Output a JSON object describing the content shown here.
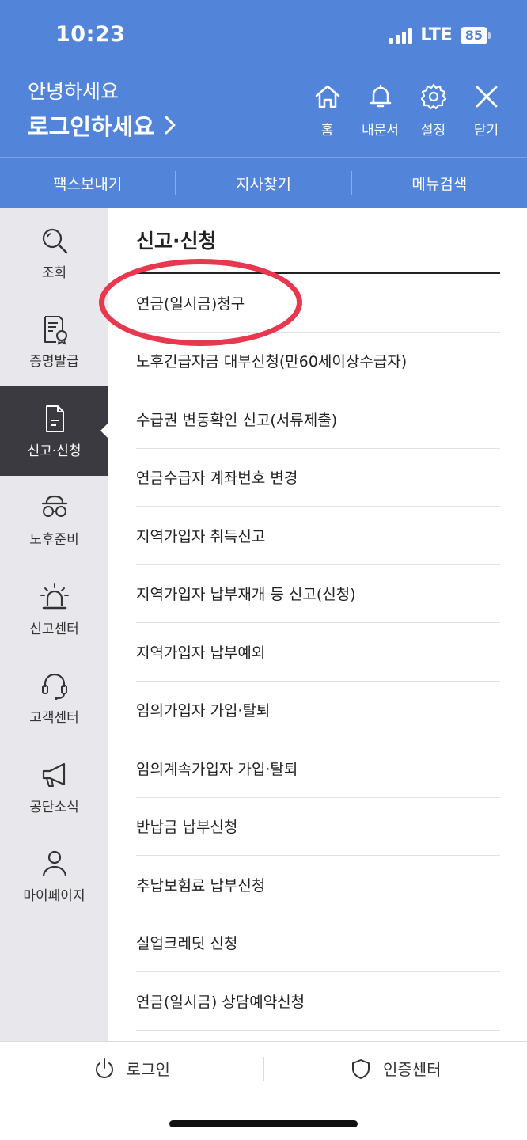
{
  "status": {
    "time": "10:23",
    "network": "LTE",
    "battery": "85"
  },
  "header": {
    "greeting": "안녕하세요",
    "login_prompt": "로그인하세요",
    "icons": [
      {
        "icon": "home-icon",
        "label": "홈"
      },
      {
        "icon": "bell-icon",
        "label": "내문서"
      },
      {
        "icon": "gear-icon",
        "label": "설정"
      },
      {
        "icon": "close-icon",
        "label": "닫기"
      }
    ]
  },
  "quick_links": [
    "팩스보내기",
    "지사찾기",
    "메뉴검색"
  ],
  "sidebar": {
    "items": [
      {
        "icon": "search-icon",
        "label": "조회"
      },
      {
        "icon": "certificate-icon",
        "label": "증명발급"
      },
      {
        "icon": "document-icon",
        "label": "신고·신청",
        "active": true
      },
      {
        "icon": "glasses-hat-icon",
        "label": "노후준비"
      },
      {
        "icon": "siren-icon",
        "label": "신고센터"
      },
      {
        "icon": "headset-icon",
        "label": "고객센터"
      },
      {
        "icon": "megaphone-icon",
        "label": "공단소식"
      },
      {
        "icon": "person-icon",
        "label": "마이페이지"
      }
    ]
  },
  "main": {
    "title": "신고·신청",
    "items": [
      "연금(일시금)청구",
      "노후긴급자금 대부신청(만60세이상수급자)",
      "수급권 변동확인 신고(서류제출)",
      "연금수급자 계좌번호 변경",
      "지역가입자 취득신고",
      "지역가입자 납부재개 등 신고(신청)",
      "지역가입자 납부예외",
      "임의가입자 가입·탈퇴",
      "임의계속가입자 가입·탈퇴",
      "반납금 납부신청",
      "추납보험료 납부신청",
      "실업크레딧 신청",
      "연금(일시금) 상담예약신청"
    ]
  },
  "bottom_bar": {
    "login": {
      "icon": "power-icon",
      "label": "로그인"
    },
    "cert": {
      "icon": "shield-icon",
      "label": "인증센터"
    }
  },
  "colors": {
    "header": "#5284d9",
    "sidebar": "#e8e8ec",
    "sidebar_active": "#3a3a40",
    "highlight": "#e8384f"
  }
}
